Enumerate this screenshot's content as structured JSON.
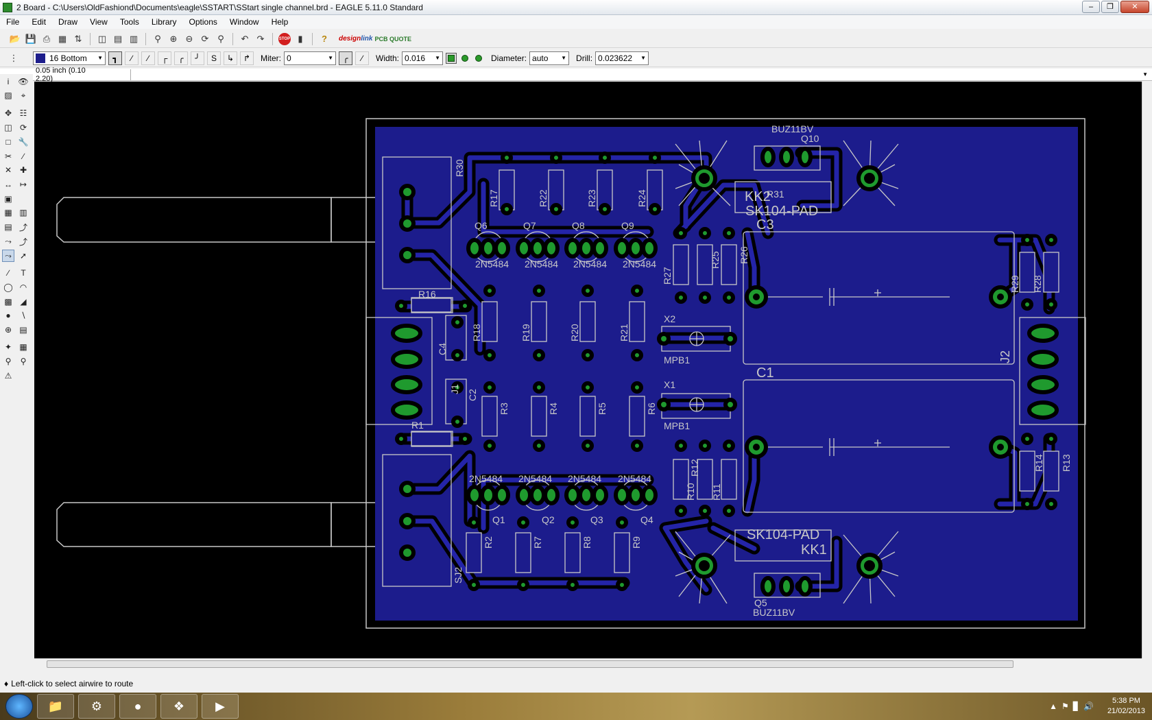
{
  "window": {
    "title": "2 Board - C:\\Users\\OldFashiond\\Documents\\eagle\\SSTART\\SStart single channel.brd - EAGLE 5.11.0 Standard"
  },
  "menu": [
    "File",
    "Edit",
    "Draw",
    "View",
    "Tools",
    "Library",
    "Options",
    "Window",
    "Help"
  ],
  "toolbar": {
    "stop_label": "STOP",
    "brand_top": "design",
    "brand_bottom": "link",
    "pcb_quote": "PCB QUOTE"
  },
  "route_toolbar": {
    "layer": "16 Bottom",
    "layer_color": "#1e1e8c",
    "miter_label": "Miter:",
    "miter_value": "0",
    "width_label": "Width:",
    "width_value": "0.016",
    "diameter_label": "Diameter:",
    "diameter_value": "auto",
    "drill_label": "Drill:",
    "drill_value": "0.023622"
  },
  "command": {
    "coordinate": "0.05 inch (0.10 2.20)",
    "input": ""
  },
  "board": {
    "copper_color": "#1c1c8c",
    "pad_color": "#1f9a2e",
    "labels": {
      "q10_value": "BUZ11BV",
      "q10": "Q10",
      "q5_value": "BUZ11BV",
      "q5": "Q5",
      "kk2": "KK2",
      "kk1": "KK1",
      "sk104_top": "SK104-PAD",
      "sk104_bottom": "SK104-PAD",
      "r31": "R31",
      "c3": "C3",
      "c1": "C1",
      "c2": "C2",
      "c4": "C4",
      "r30": "R30",
      "r16": "R16",
      "r1": "R1",
      "x1": "X1",
      "x2": "X2",
      "mpb1_top": "MPB1",
      "mpb1_bottom": "MPB1",
      "j1": "J1",
      "j2": "J2",
      "sj2": "SJ2",
      "q6": "Q6",
      "q7": "Q7",
      "q8": "Q8",
      "q9": "Q9",
      "q1": "Q1",
      "q2": "Q2",
      "q3": "Q3",
      "q4": "Q4",
      "r17": "R17",
      "r22": "R22",
      "r23": "R23",
      "r24": "R24",
      "r18": "R18",
      "r19": "R19",
      "r20": "R20",
      "r21": "R21",
      "r3": "R3",
      "r4": "R4",
      "r5": "R5",
      "r6": "R6",
      "r2": "R2",
      "r7": "R7",
      "r8": "R8",
      "r9": "R9",
      "r25": "R25",
      "r26": "R26",
      "r27": "R27",
      "r10": "R10",
      "r11": "R11",
      "r12": "R12",
      "r28": "R28",
      "r29": "R29",
      "r13": "R13",
      "r14": "R14",
      "jfet": "2N5484"
    }
  },
  "status": {
    "message": "Left-click to select airwire to route"
  },
  "taskbar": {
    "time": "5:38 PM",
    "date": "21/02/2013"
  }
}
